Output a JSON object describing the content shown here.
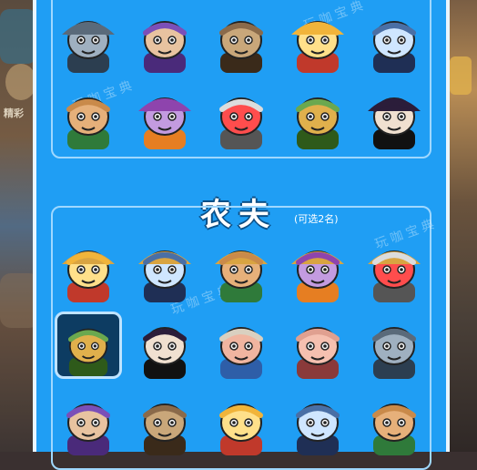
{
  "section": {
    "title": "农夫",
    "note": "(可选2名)"
  },
  "watermark": "玩咖宝典",
  "side_left_hint": "精彩",
  "caption": "",
  "top_characters": [
    {
      "name": "armored-knight"
    },
    {
      "name": "purple-wizard"
    },
    {
      "name": "gorilla"
    },
    {
      "name": "lion-warrior"
    },
    {
      "name": "jiangshi"
    },
    {
      "name": "scarecrow"
    },
    {
      "name": "purple-crocodile"
    },
    {
      "name": "robot"
    },
    {
      "name": "zombie-farmer"
    },
    {
      "name": "ghost-girl"
    }
  ],
  "farmer_characters": [
    {
      "name": "farmer-pitchfork",
      "selected": false
    },
    {
      "name": "pig-farmer-hat",
      "selected": false
    },
    {
      "name": "bearded-farmer",
      "selected": false
    },
    {
      "name": "leopard-farmer",
      "selected": false
    },
    {
      "name": "chef-beard",
      "selected": false
    },
    {
      "name": "glasses-boy",
      "selected": true
    },
    {
      "name": "pig",
      "selected": false
    },
    {
      "name": "green-boy",
      "selected": false
    },
    {
      "name": "helmet-rider",
      "selected": false
    },
    {
      "name": "bald-monk",
      "selected": false
    },
    {
      "name": "mustache-man",
      "selected": false
    },
    {
      "name": "astronaut",
      "selected": false
    },
    {
      "name": "lucky-cat",
      "selected": false
    },
    {
      "name": "cactus-warrior",
      "selected": false
    },
    {
      "name": "smiley-face",
      "selected": false
    }
  ],
  "colors": {
    "panel": "#1f9ef4",
    "border": "#9fd8ff",
    "selected": "#0d3c62"
  }
}
